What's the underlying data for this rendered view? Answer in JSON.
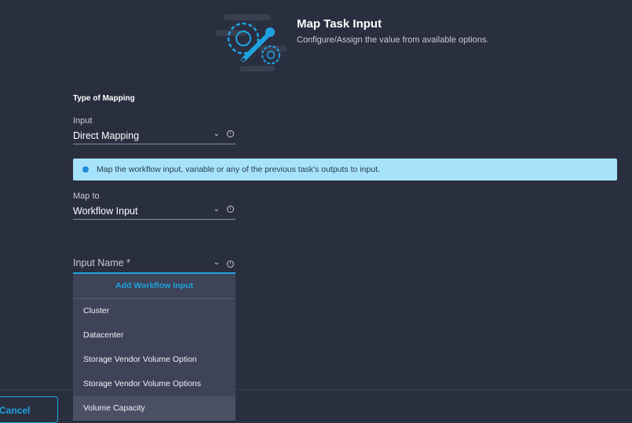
{
  "header": {
    "title": "Map Task Input",
    "subtitle": "Configure/Assign the value from available options."
  },
  "form": {
    "section_title": "Type of Mapping",
    "input_label": "Input",
    "input_value": "Direct Mapping",
    "banner_text": "Map the workflow input, variable or any of the previous task's outputs to input.",
    "map_to_label": "Map to",
    "map_to_value": "Workflow Input",
    "input_name_placeholder": "Input Name *"
  },
  "dropdown": {
    "add_label": "Add Workflow Input",
    "items": [
      "Cluster",
      "Datacenter",
      "Storage Vendor Volume Option",
      "Storage Vendor Volume Options",
      "Volume Capacity"
    ]
  },
  "footer": {
    "cancel_label": "Cancel"
  },
  "colors": {
    "accent": "#1fa3e0",
    "background": "#2a2f40",
    "banner": "#a6e3fb"
  }
}
